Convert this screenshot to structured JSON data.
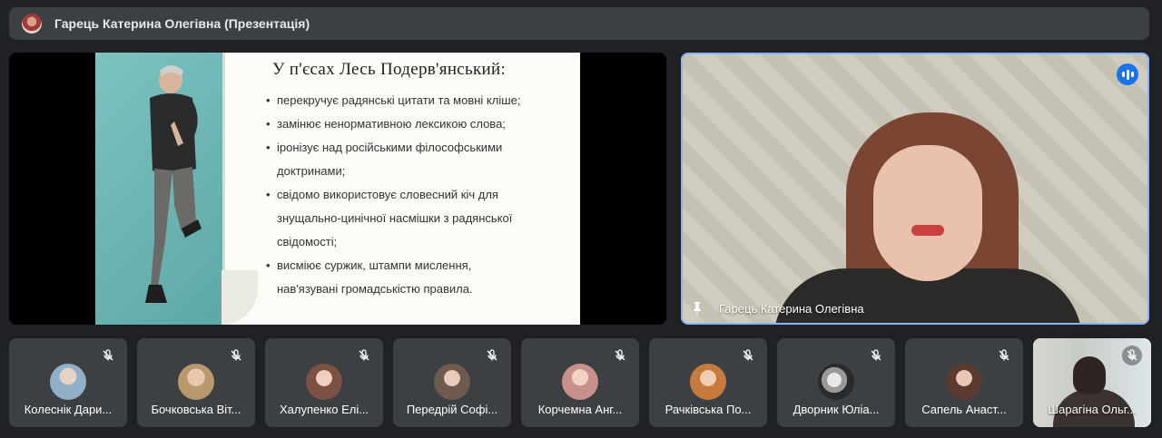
{
  "header": {
    "presenter_title": "Гарець Катерина Олегівна (Презентація)"
  },
  "slide": {
    "title": "У п'єсах Лесь Подерв'янський:",
    "bullets": [
      {
        "line1": "перекручує радянські цитати та мовні кліше;",
        "line2": ""
      },
      {
        "line1": "замінює ненормативною лексикою слова;",
        "line2": ""
      },
      {
        "line1": "іронізує над російськими філософськими",
        "line2": "доктринами;"
      },
      {
        "line1": "свідомо використовує словесний кіч для",
        "line2": "знущально-цинічної насмішки з радянської",
        "line3": "свідомості;"
      },
      {
        "line1": "висміює суржик, штампи мислення,",
        "line2": "нав'язувані громадськістю правила."
      }
    ],
    "bullet_glyph": "•"
  },
  "speaker": {
    "name": "Гарець Катерина Олегівна",
    "highlight_color": "#8ab4f8",
    "speaking_indicator_color": "#1a73e8"
  },
  "participants": [
    {
      "name": "Колеснік Дари...",
      "avatar_color": "#8fb0c8"
    },
    {
      "name": "Бочковська Віт...",
      "avatar_color": "#b9986e"
    },
    {
      "name": "Халупенко Елі...",
      "avatar_color": "#7a5142"
    },
    {
      "name": "Передрій Софі...",
      "avatar_color": "#6f5b4e"
    },
    {
      "name": "Корчемна Анг...",
      "avatar_color": "#c98f8a"
    },
    {
      "name": "Рачківська По...",
      "avatar_color": "#c67a3e"
    },
    {
      "name": "Дворник Юліа...",
      "avatar_color": "#cfcfcf"
    },
    {
      "name": "Сапель Анаст...",
      "avatar_color": "#5a3b30"
    },
    {
      "name": "Шарагіна Ольг...",
      "avatar_color": ""
    }
  ],
  "icons": {
    "mute": "mic-off-icon",
    "pin": "pin-icon",
    "speaking": "audio-level-icon"
  }
}
